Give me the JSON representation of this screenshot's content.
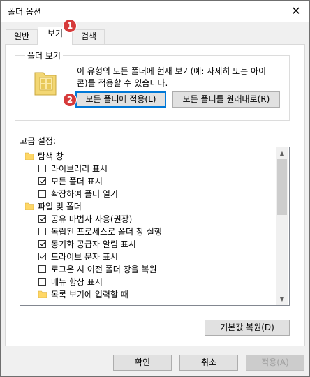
{
  "window": {
    "title": "폴더 옵션",
    "close_symbol": "✕"
  },
  "tabs": [
    {
      "label": "일반"
    },
    {
      "label": "보기"
    },
    {
      "label": "검색"
    }
  ],
  "folder_view": {
    "group_label": "폴더 보기",
    "description_line1": "이 유형의 모든 폴더에 현재 보기(예: 자세히 또는 아이",
    "description_line2": "콘)를 적용할 수 있습니다.",
    "apply_button": "모든 폴더에 적용(L)",
    "reset_button": "모든 폴더를 원래대로(R)"
  },
  "advanced": {
    "label": "고급 설정:",
    "items": [
      {
        "type": "folder",
        "level": 0,
        "text": "탐색 창"
      },
      {
        "type": "checkbox",
        "level": 1,
        "checked": false,
        "text": "라이브러리 표시"
      },
      {
        "type": "checkbox",
        "level": 1,
        "checked": true,
        "text": "모든 폴더 표시"
      },
      {
        "type": "checkbox",
        "level": 1,
        "checked": false,
        "text": "확장하여 폴더 열기"
      },
      {
        "type": "folder",
        "level": 0,
        "text": "파일 및 폴더"
      },
      {
        "type": "checkbox",
        "level": 1,
        "checked": true,
        "text": "공유 마법사 사용(권장)"
      },
      {
        "type": "checkbox",
        "level": 1,
        "checked": false,
        "text": "독립된 프로세스로 폴더 창 실행"
      },
      {
        "type": "checkbox",
        "level": 1,
        "checked": true,
        "text": "동기화 공급자 알림 표시"
      },
      {
        "type": "checkbox",
        "level": 1,
        "checked": true,
        "text": "드라이브 문자 표시"
      },
      {
        "type": "checkbox",
        "level": 1,
        "checked": false,
        "text": "로그온 시 이전 폴더 창을 복원"
      },
      {
        "type": "checkbox",
        "level": 1,
        "checked": false,
        "text": "메뉴 항상 표시"
      },
      {
        "type": "folder",
        "level": 1,
        "text": "목록 보기에 입력할 때"
      }
    ],
    "restore_defaults_button": "기본값 복원(D)"
  },
  "footer": {
    "ok": "확인",
    "cancel": "취소",
    "apply": "적용(A)"
  },
  "badges": [
    "1",
    "2"
  ],
  "colors": {
    "badge": "#d63a3a",
    "focus": "#0078d7",
    "folder": "#ffd766"
  }
}
